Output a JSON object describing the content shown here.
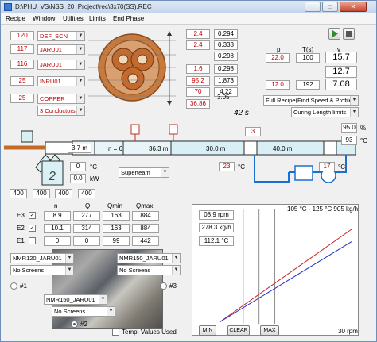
{
  "window": {
    "title": "D:\\PHU_VS\\NSS_20_Project\\rec\\3x70(SS).REC",
    "minimize": "_",
    "maximize": "□",
    "close": "✕"
  },
  "menu": [
    "Recipe",
    "Window",
    "Utilities",
    "Limits",
    "End Phase"
  ],
  "conductors": {
    "rows": [
      {
        "num": "120",
        "name": "DEF_SCN"
      },
      {
        "num": "117",
        "name": "JARU01"
      },
      {
        "num": "116",
        "name": "JARU01"
      },
      {
        "num": "25",
        "name": "INRU01"
      },
      {
        "num": "25",
        "name": "COPPER"
      }
    ],
    "count": "3 Conductors"
  },
  "dims": {
    "left": [
      "2.4",
      "2.4",
      "1.6",
      "95.2",
      "70",
      "36.86"
    ],
    "right": [
      "0.294",
      "0.333",
      "0.298",
      "0.298",
      "1.873",
      "4.22",
      "3.05"
    ]
  },
  "time": "42 s",
  "params": {
    "headers": {
      "p": "p",
      "t": "T(s)",
      "v": "v"
    },
    "rows": [
      {
        "p": "22.0",
        "t": "100",
        "v": "15.7"
      },
      {
        "p": "",
        "t": "",
        "v": "12.7"
      },
      {
        "p": "12.0",
        "t": "192",
        "v": "7.08"
      }
    ]
  },
  "recipe_mode": "Full Recipe(Find Speed & Profile)",
  "length_limit": "Curing Length limits",
  "line": {
    "zone1": "3.7 m",
    "n": "n = 6",
    "zone2": "36.3 m",
    "zone3": "30.0 m",
    "zone4": "40.0 m",
    "gauge_value": "3",
    "temp_c": "°C",
    "pct": "95.0",
    "pct_unit": "%",
    "temp_right": "93",
    "temp_right_unit": "°C",
    "temp_mid": "23",
    "temp_mid_unit": "°C",
    "temp_low": "17",
    "temp_low_unit": "°C",
    "preheat": "0",
    "preheat_unit": "°C",
    "power": "0.0",
    "power_unit": "kW",
    "steam": "Superteam",
    "drums": [
      "400",
      "400",
      "400",
      "400"
    ]
  },
  "extruders": {
    "headers": [
      "n",
      "Q",
      "Qmin",
      "Qmax"
    ],
    "rows": [
      {
        "label": "E3",
        "checked": "✓",
        "n": "8.9",
        "q": "277",
        "qmin": "163",
        "qmax": "884"
      },
      {
        "label": "E2",
        "checked": "✓",
        "n": "10.1",
        "q": "314",
        "qmin": "163",
        "qmax": "884"
      },
      {
        "label": "E1",
        "checked": "",
        "n": "0",
        "q": "0",
        "qmin": "99",
        "qmax": "442"
      }
    ]
  },
  "screens": {
    "ex1": {
      "machine": "NMR120_JARU01",
      "screen": "No Screens",
      "label": "#1"
    },
    "ex3": {
      "machine": "NMR150_JARU01",
      "screen": "No Screens",
      "label": "#3"
    },
    "ex2": {
      "machine": "NMR150_JARU01",
      "screen": "No Screens",
      "label": "#2"
    }
  },
  "temp_values_label": "Temp. Values Used",
  "readouts": [
    "08.9 rpm",
    "278.3 kg/h",
    "112.1 °C"
  ],
  "chart_data": {
    "type": "line",
    "annotation": "105 °C - 125 °C 905 kg/h",
    "x_end_label": "30 rpm",
    "series": [
      {
        "color": "#cc2222",
        "values": [
          [
            0,
            0
          ],
          [
            30,
            0.9
          ]
        ]
      },
      {
        "color": "#2233cc",
        "values": [
          [
            0,
            0
          ],
          [
            30,
            0.78
          ]
        ]
      }
    ],
    "xlim": [
      0,
      30
    ],
    "ylim": [
      0,
      1
    ]
  },
  "chart_buttons": {
    "min": "MIN",
    "clear": "CLEAR",
    "max": "MAX"
  }
}
